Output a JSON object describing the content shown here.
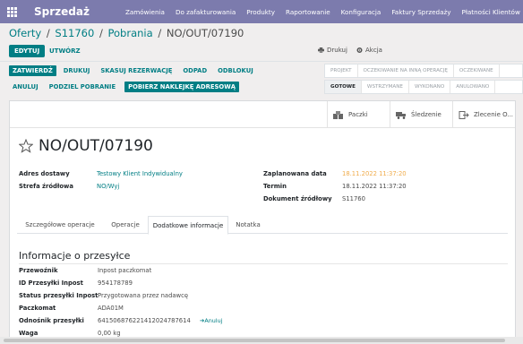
{
  "app": {
    "brand": "Sprzedaż",
    "menu": [
      "Zamówienia",
      "Do zafakturowania",
      "Produkty",
      "Raportowanie",
      "Konfiguracja",
      "Faktury Sprzedaży",
      "Płatności Klientów"
    ]
  },
  "breadcrumb": {
    "items": [
      "Oferty",
      "S11760",
      "Pobrania"
    ],
    "separator": "/",
    "current": "NO/OUT/07190"
  },
  "control": {
    "edit_label": "EDYTUJ",
    "create_label": "UTWÓRZ",
    "print_label": "Drukuj",
    "action_label": "Akcja"
  },
  "buttons_row1": [
    "ZATWIERDŹ",
    "DRUKUJ",
    "SKASUJ REZERWACJĘ",
    "ODPAD",
    "ODBLOKUJ"
  ],
  "buttons_row2": [
    "ANULUJ",
    "PODZIEL POBRANIE",
    "POBIERZ NAKLEJKĘ ADRESOWĄ"
  ],
  "stages_row1": [
    "PROJEKT",
    "OCZEKIWANIE NA INNĄ OPERACJĘ",
    "OCZEKIWANE"
  ],
  "stages_row2": [
    "GOTOWE",
    "WSTRZYMANE",
    "WYKONANO",
    "ANULOWANO"
  ],
  "smart_buttons": {
    "packages": "Paczki",
    "tracking": "Śledzenie",
    "order": "Zlecenie O..."
  },
  "record": {
    "name": "NO/OUT/07190"
  },
  "fields": {
    "delivery_address_label": "Adres dostawy",
    "delivery_address": "Testowy Klient Indywidualny",
    "source_zone_label": "Strefa źródłowa",
    "source_zone": "NO/Wyj",
    "scheduled_label": "Zaplanowana data",
    "scheduled": "18.11.2022 11:37:20",
    "deadline_label": "Termin",
    "deadline": "18.11.2022 11:37:20",
    "source_doc_label": "Dokument źródłowy",
    "source_doc": "S11760"
  },
  "tabs": [
    "Szczegółowe operacje",
    "Operacje",
    "Dodatkowe informacje",
    "Notatka"
  ],
  "active_tab": "Dodatkowe informacje",
  "shipment": {
    "title": "Informacje o przesyłce",
    "rows": [
      {
        "label": "Przewoźnik",
        "value": "Inpost paczkomat"
      },
      {
        "label": "ID Przesyłki Inpost",
        "value": "954178789"
      },
      {
        "label": "Status przesyłki Inpost",
        "value": "Przygotowana przez nadawcę"
      },
      {
        "label": "Paczkomat",
        "value": "ADA01M"
      },
      {
        "label": "Odnośnik przesyłki",
        "value": "641506876221412024787614"
      },
      {
        "label": "Waga",
        "value": "0,00 kg"
      }
    ],
    "action_label": "Anuluj"
  },
  "colors": {
    "navbar": "#7c7bad",
    "primary": "#017e84",
    "warning": "#f0ad4e"
  }
}
